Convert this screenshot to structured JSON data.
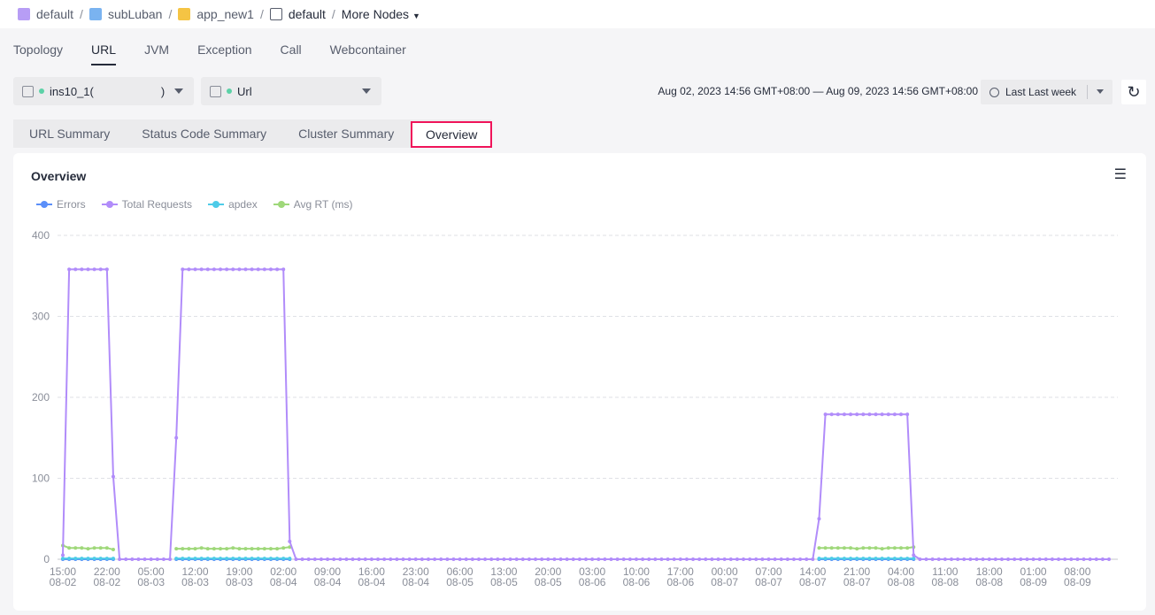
{
  "breadcrumb": {
    "items": [
      {
        "label": "default",
        "icon": "workspace-icon"
      },
      {
        "label": "subLuban",
        "icon": "folder-icon"
      },
      {
        "label": "app_new1",
        "icon": "cube-icon"
      },
      {
        "label": "default",
        "icon": "code-window-icon"
      }
    ],
    "more": "More Nodes"
  },
  "tabs": [
    "Topology",
    "URL",
    "JVM",
    "Exception",
    "Call",
    "Webcontainer"
  ],
  "active_tab": "URL",
  "instance_select": {
    "value": "ins10_1(",
    "suffix": ")"
  },
  "type_select": {
    "value": "Url"
  },
  "time_range": "Aug 02, 2023 14:56 GMT+08:00 — Aug 09, 2023 14:56 GMT+08:00",
  "quick_range": "Last Last week",
  "subtabs": [
    "URL Summary",
    "Status Code Summary",
    "Cluster Summary",
    "Overview"
  ],
  "active_subtab": "Overview",
  "card": {
    "title": "Overview"
  },
  "chart_data": {
    "type": "line",
    "title": "Overview",
    "ylim": [
      0,
      400
    ],
    "yticks": [
      "0",
      "100",
      "200",
      "300",
      "400"
    ],
    "grid": true,
    "legend_position": "top-left",
    "x_start": "08-02 15:00",
    "x_step_hours": 1,
    "xticks": [
      [
        "15:00",
        "08-02"
      ],
      [
        "22:00",
        "08-02"
      ],
      [
        "05:00",
        "08-03"
      ],
      [
        "12:00",
        "08-03"
      ],
      [
        "19:00",
        "08-03"
      ],
      [
        "02:00",
        "08-04"
      ],
      [
        "09:00",
        "08-04"
      ],
      [
        "16:00",
        "08-04"
      ],
      [
        "23:00",
        "08-04"
      ],
      [
        "06:00",
        "08-05"
      ],
      [
        "13:00",
        "08-05"
      ],
      [
        "20:00",
        "08-05"
      ],
      [
        "03:00",
        "08-06"
      ],
      [
        "10:00",
        "08-06"
      ],
      [
        "17:00",
        "08-06"
      ],
      [
        "00:00",
        "08-07"
      ],
      [
        "07:00",
        "08-07"
      ],
      [
        "14:00",
        "08-07"
      ],
      [
        "21:00",
        "08-07"
      ],
      [
        "04:00",
        "08-08"
      ],
      [
        "11:00",
        "08-08"
      ],
      [
        "18:00",
        "08-08"
      ],
      [
        "01:00",
        "08-09"
      ],
      [
        "08:00",
        "08-09"
      ]
    ],
    "series": [
      {
        "name": "Errors",
        "color": "#5b8ff9",
        "values": [
          0,
          0,
          0,
          0,
          0,
          0,
          0,
          0,
          0,
          null,
          null,
          null,
          null,
          null,
          null,
          null,
          null,
          null,
          0,
          0,
          0,
          0,
          0,
          0,
          0,
          0,
          0,
          0,
          0,
          0,
          0,
          0,
          0,
          0,
          0,
          0,
          0,
          null,
          null,
          null,
          null,
          null,
          null,
          null,
          null,
          null,
          null,
          null,
          null,
          null,
          null,
          null,
          null,
          null,
          null,
          null,
          null,
          null,
          null,
          null,
          null,
          null,
          null,
          null,
          null,
          null,
          null,
          null,
          null,
          null,
          null,
          null,
          null,
          null,
          null,
          null,
          null,
          null,
          null,
          null,
          null,
          null,
          null,
          null,
          null,
          null,
          null,
          null,
          null,
          null,
          null,
          null,
          null,
          null,
          null,
          null,
          null,
          null,
          null,
          null,
          null,
          null,
          null,
          null,
          null,
          null,
          null,
          null,
          null,
          null,
          null,
          null,
          null,
          null,
          null,
          null,
          null,
          null,
          null,
          null,
          0,
          0,
          0,
          0,
          0,
          0,
          0,
          0,
          0,
          0,
          0,
          0,
          0,
          0,
          0,
          0,
          null,
          null,
          null,
          null,
          null,
          null,
          null,
          null,
          null,
          null,
          null,
          null,
          null,
          null,
          null,
          null,
          null,
          null,
          null,
          null,
          null,
          null,
          null,
          null,
          null,
          null,
          null,
          null,
          null,
          null,
          null
        ]
      },
      {
        "name": "Total Requests",
        "color": "#b18cfa",
        "values": [
          5,
          358,
          358,
          358,
          358,
          358,
          358,
          358,
          102,
          0,
          0,
          0,
          0,
          0,
          0,
          0,
          0,
          0,
          150,
          358,
          358,
          358,
          358,
          358,
          358,
          358,
          358,
          358,
          358,
          358,
          358,
          358,
          358,
          358,
          358,
          358,
          22,
          0,
          0,
          0,
          0,
          0,
          0,
          0,
          0,
          0,
          0,
          0,
          0,
          0,
          0,
          0,
          0,
          0,
          0,
          0,
          0,
          0,
          0,
          0,
          0,
          0,
          0,
          0,
          0,
          0,
          0,
          0,
          0,
          0,
          0,
          0,
          0,
          0,
          0,
          0,
          0,
          0,
          0,
          0,
          0,
          0,
          0,
          0,
          0,
          0,
          0,
          0,
          0,
          0,
          0,
          0,
          0,
          0,
          0,
          0,
          0,
          0,
          0,
          0,
          0,
          0,
          0,
          0,
          0,
          0,
          0,
          0,
          0,
          0,
          0,
          0,
          0,
          0,
          0,
          0,
          0,
          0,
          0,
          0,
          50,
          179,
          179,
          179,
          179,
          179,
          179,
          179,
          179,
          179,
          179,
          179,
          179,
          179,
          179,
          5,
          0,
          0,
          0,
          0,
          0,
          0,
          0,
          0,
          0,
          0,
          0,
          0,
          0,
          0,
          0,
          0,
          0,
          0,
          0,
          0,
          0,
          0,
          0,
          0,
          0,
          0,
          0,
          0,
          0,
          0,
          0
        ]
      },
      {
        "name": "apdex",
        "color": "#4ecbe8",
        "values": [
          1,
          1,
          1,
          1,
          1,
          1,
          1,
          1,
          1,
          null,
          null,
          null,
          null,
          null,
          null,
          null,
          null,
          null,
          1,
          1,
          1,
          1,
          1,
          1,
          1,
          1,
          1,
          1,
          1,
          1,
          1,
          1,
          1,
          1,
          1,
          1,
          1,
          null,
          null,
          null,
          null,
          null,
          null,
          null,
          null,
          null,
          null,
          null,
          null,
          null,
          null,
          null,
          null,
          null,
          null,
          null,
          null,
          null,
          null,
          null,
          null,
          null,
          null,
          null,
          null,
          null,
          null,
          null,
          null,
          null,
          null,
          null,
          null,
          null,
          null,
          null,
          null,
          null,
          null,
          null,
          null,
          null,
          null,
          null,
          null,
          null,
          null,
          null,
          null,
          null,
          null,
          null,
          null,
          null,
          null,
          null,
          null,
          null,
          null,
          null,
          null,
          null,
          null,
          null,
          null,
          null,
          null,
          null,
          null,
          null,
          null,
          null,
          null,
          null,
          null,
          null,
          null,
          null,
          null,
          null,
          1,
          1,
          1,
          1,
          1,
          1,
          1,
          1,
          1,
          1,
          1,
          1,
          1,
          1,
          1,
          1,
          null,
          null,
          null,
          null,
          null,
          null,
          null,
          null,
          null,
          null,
          null,
          null,
          null,
          null,
          null,
          null,
          null,
          null,
          null,
          null,
          null,
          null,
          null,
          null,
          null,
          null,
          null,
          null,
          null,
          null,
          null
        ]
      },
      {
        "name": "Avg RT (ms)",
        "color": "#9fd87a",
        "values": [
          17,
          14,
          14,
          14,
          13,
          14,
          14,
          14,
          12,
          null,
          null,
          null,
          null,
          null,
          null,
          null,
          null,
          null,
          13,
          13,
          13,
          13,
          14,
          13,
          13,
          13,
          13,
          14,
          13,
          13,
          13,
          13,
          13,
          13,
          13,
          14,
          15,
          null,
          null,
          null,
          null,
          null,
          null,
          null,
          null,
          null,
          null,
          null,
          null,
          null,
          null,
          null,
          null,
          null,
          null,
          null,
          null,
          null,
          null,
          null,
          null,
          null,
          null,
          null,
          null,
          null,
          null,
          null,
          null,
          null,
          null,
          null,
          null,
          null,
          null,
          null,
          null,
          null,
          null,
          null,
          null,
          null,
          null,
          null,
          null,
          null,
          null,
          null,
          null,
          null,
          null,
          null,
          null,
          null,
          null,
          null,
          null,
          null,
          null,
          null,
          null,
          null,
          null,
          null,
          null,
          null,
          null,
          null,
          null,
          null,
          null,
          null,
          null,
          null,
          null,
          null,
          null,
          null,
          null,
          null,
          14,
          14,
          14,
          14,
          14,
          14,
          13,
          14,
          14,
          14,
          13,
          14,
          14,
          14,
          14,
          15,
          null,
          null,
          null,
          null,
          null,
          null,
          null,
          null,
          null,
          null,
          null,
          null,
          null,
          null,
          null,
          null,
          null,
          null,
          null,
          null,
          null,
          null,
          null,
          null,
          null,
          null,
          null,
          null,
          null,
          null,
          null
        ]
      }
    ]
  }
}
